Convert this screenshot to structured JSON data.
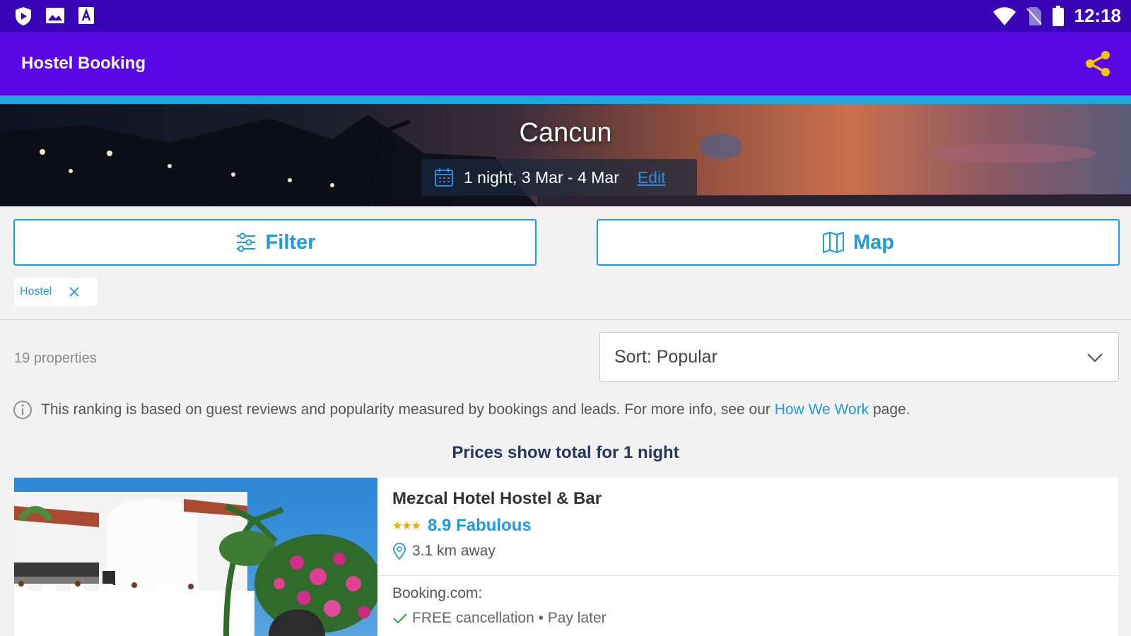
{
  "status_bar": {
    "time": "12:18",
    "left_icons": [
      "shield-icon",
      "image-icon",
      "font-icon"
    ],
    "right_icons": [
      "wifi-icon",
      "no-sim-icon",
      "battery-icon"
    ]
  },
  "app_bar": {
    "title": "Hostel Booking",
    "share_icon": "share-icon",
    "share_color": "#f5c400",
    "background": "#5a07e6"
  },
  "hero": {
    "city": "Cancun",
    "dates": "1 night, 3 Mar - 4 Mar",
    "edit_label": "Edit"
  },
  "actions": {
    "filter_label": "Filter",
    "map_label": "Map"
  },
  "chips": [
    {
      "label": "Hostel"
    }
  ],
  "results": {
    "count": "19 properties",
    "sort_label": "Sort: Popular",
    "info_text": "This ranking is based on guest reviews and popularity measured by bookings and leads. For more info, see our ",
    "info_link": "How We Work",
    "info_suffix": " page.",
    "prices_note": "Prices show total for 1 night"
  },
  "listings": [
    {
      "name": "Mezcal Hotel Hostel & Bar",
      "stars": "★★★",
      "score": "8.9 Fabulous",
      "distance": "3.1 km away",
      "provider": "Booking.com:",
      "cancellation": "FREE cancellation • Pay later"
    }
  ],
  "colors": {
    "accent": "#1d9be0",
    "status_bar": "#3a05b6",
    "progress": "#1fa8e0",
    "heading": "#27365a"
  }
}
